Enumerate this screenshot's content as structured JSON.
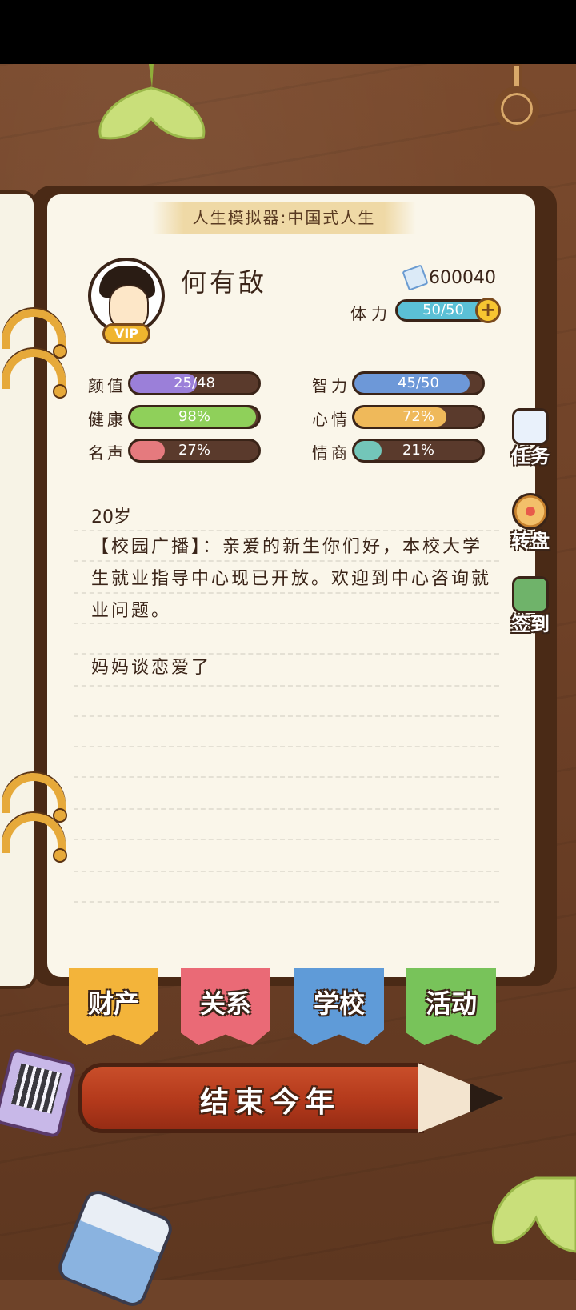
{
  "header": {
    "title": "人生模拟器:中国式人生"
  },
  "player": {
    "name": "何有敌",
    "vip": "VIP",
    "money": "600040",
    "stamina_label": "体力",
    "stamina": "50/50",
    "stamina_fraction": 1.0
  },
  "stats": [
    {
      "label": "颜值",
      "value": "25/48",
      "fraction": 0.52,
      "color": "#9b7fd9"
    },
    {
      "label": "智力",
      "value": "45/50",
      "fraction": 0.9,
      "color": "#6d98d8"
    },
    {
      "label": "健康",
      "value": "98%",
      "fraction": 0.98,
      "color": "#8fd05a"
    },
    {
      "label": "心情",
      "value": "72%",
      "fraction": 0.72,
      "color": "#efb95a"
    },
    {
      "label": "名声",
      "value": "27%",
      "fraction": 0.27,
      "color": "#e57a7e"
    },
    {
      "label": "情商",
      "value": "21%",
      "fraction": 0.21,
      "color": "#73c6b9"
    }
  ],
  "log": {
    "age": "20岁",
    "entries": [
      "【校园广播】：亲爱的新生你们好，本校大学生就业指导中心现已开放。欢迎到中心咨询就业问题。",
      "妈妈谈恋爱了"
    ]
  },
  "side_buttons": [
    {
      "label": "任务",
      "icon": "clipboard-icon"
    },
    {
      "label": "转盘",
      "icon": "wheel-icon"
    },
    {
      "label": "签到",
      "icon": "checkin-book-icon"
    }
  ],
  "tabs": [
    {
      "label": "财产",
      "color": "#f3b43a"
    },
    {
      "label": "关系",
      "color": "#ea6a76"
    },
    {
      "label": "学校",
      "color": "#5f9bd8"
    },
    {
      "label": "活动",
      "color": "#78c35a"
    }
  ],
  "end_year_button": "结束今年"
}
